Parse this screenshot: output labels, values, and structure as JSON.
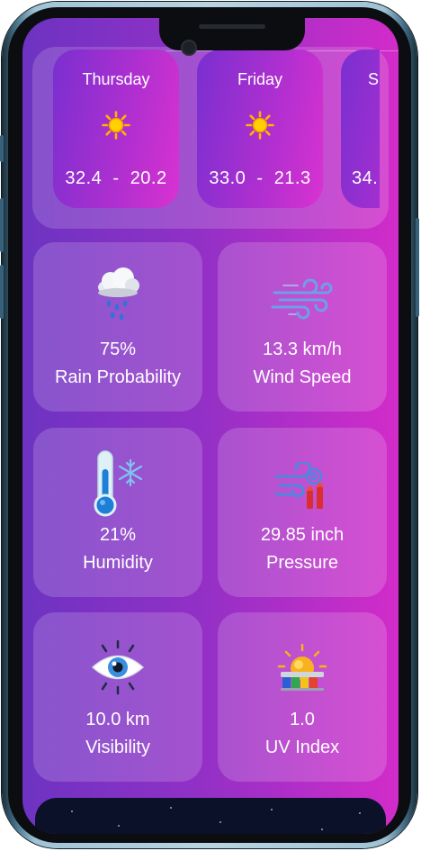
{
  "forecast": [
    {
      "day": "Thursday",
      "icon": "sun-icon",
      "low_high": "32.4  -  20.2"
    },
    {
      "day": "Friday",
      "icon": "sun-icon",
      "low_high": "33.0  -  21.3"
    },
    {
      "day": "S",
      "icon": "sun-icon",
      "low_high": "34."
    }
  ],
  "stats": {
    "rain": {
      "value": "75%",
      "label": "Rain Probability",
      "icon": "rain-cloud-icon"
    },
    "wind": {
      "value": "13.3 km/h",
      "label": "Wind Speed",
      "icon": "wind-icon"
    },
    "humidity": {
      "value": "21%",
      "label": "Humidity",
      "icon": "thermometer-snow-icon"
    },
    "pressure": {
      "value": "29.85 inch",
      "label": "Pressure",
      "icon": "pressure-gauge-icon"
    },
    "visibility": {
      "value": "10.0 km",
      "label": "Visibility",
      "icon": "eye-icon"
    },
    "uv": {
      "value": "1.0",
      "label": "UV Index",
      "icon": "uv-index-icon"
    }
  },
  "colors": {
    "gradient_start": "#6d33c2",
    "gradient_end": "#d22cc9",
    "sun": "#ffcc00"
  }
}
